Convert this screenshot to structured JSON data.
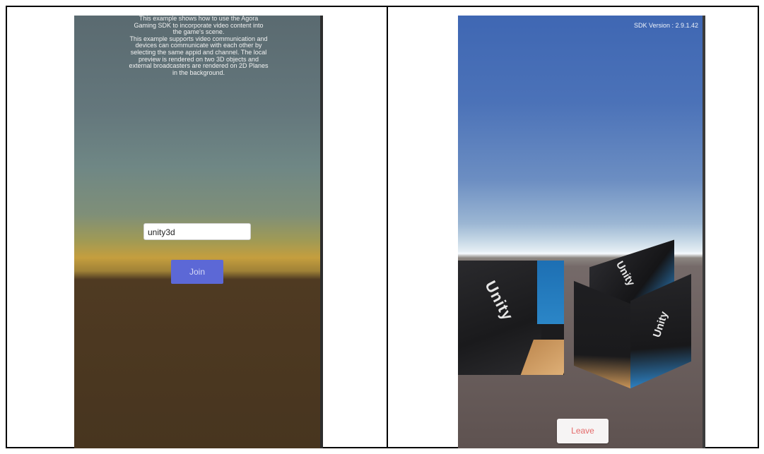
{
  "join_screen": {
    "description_lines": [
      "This example shows how to use the Agora",
      "Gaming SDK to incorporate video content into",
      "the game's scene.",
      "This example supports video communication and",
      "devices can communicate with each other by",
      "selecting the same appid and channel. The local",
      "preview is rendered on two 3D objects and",
      "external broadcasters are rendered on 2D Planes",
      "in the background."
    ],
    "channel_value": "unity3d",
    "join_label": "Join"
  },
  "call_screen": {
    "sdk_version": "SDK Version : 2.9.1.42",
    "leave_label": "Leave",
    "plane_logo": "Unity",
    "cube_logo": "Unity"
  },
  "colors": {
    "join_button": "#5c68d6",
    "leave_text": "#e46a6a"
  }
}
